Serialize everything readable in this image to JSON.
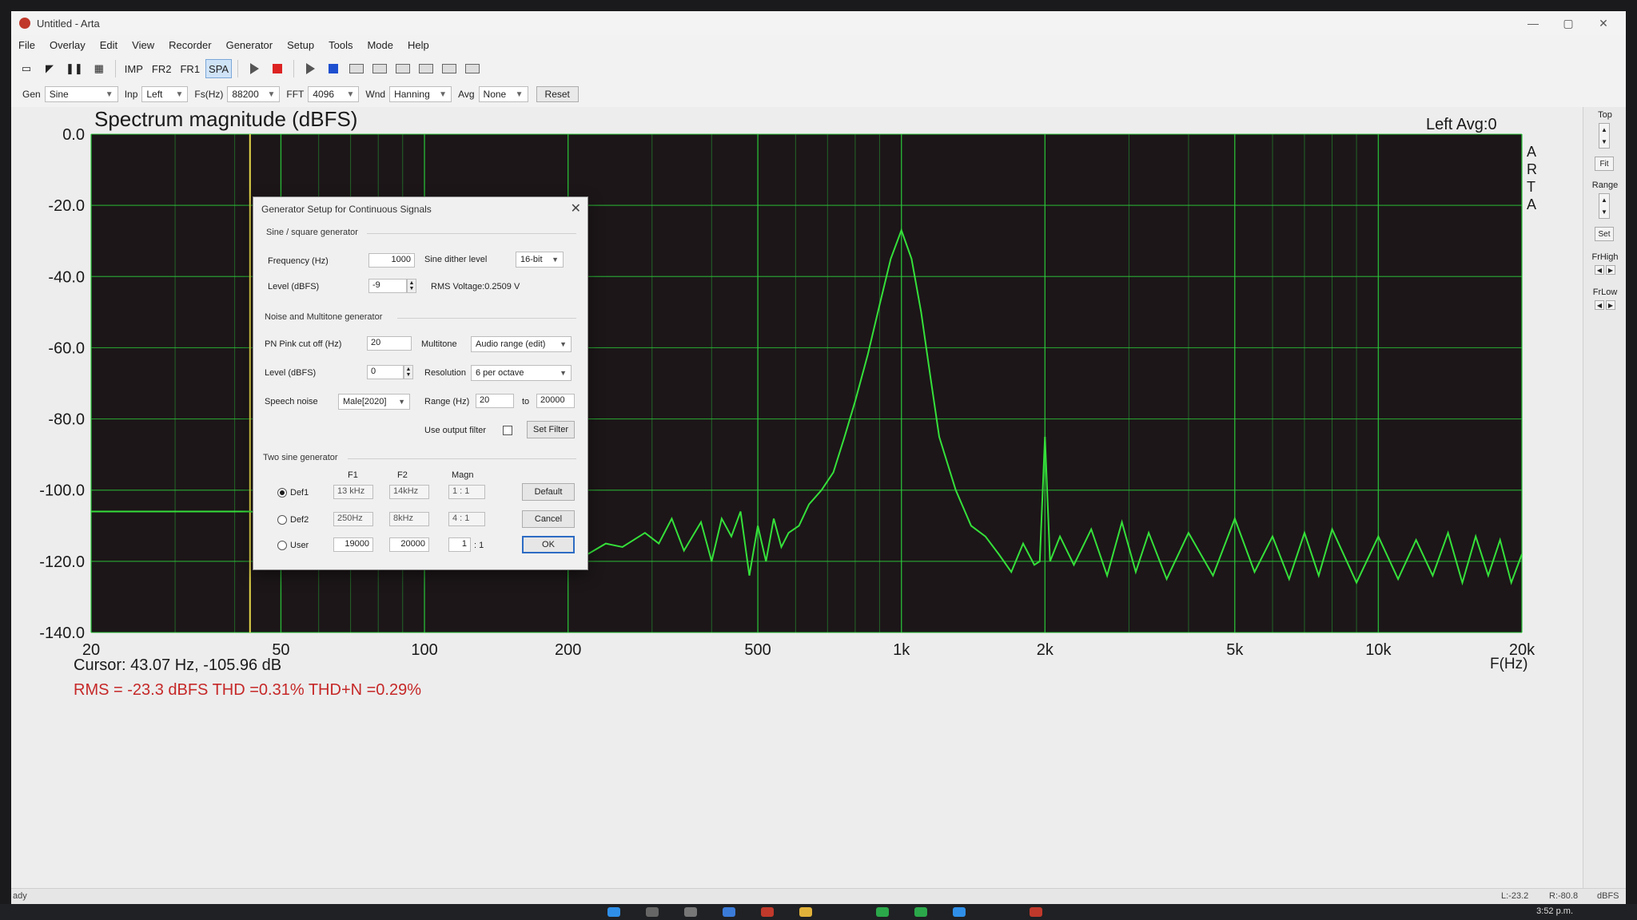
{
  "window": {
    "title": "Untitled - Arta",
    "controls": [
      "—",
      "▢",
      "✕"
    ]
  },
  "menu": [
    "File",
    "Overlay",
    "Edit",
    "View",
    "Recorder",
    "Generator",
    "Setup",
    "Tools",
    "Mode",
    "Help"
  ],
  "toolbar": {
    "imp": "IMP",
    "fr2": "FR2",
    "fr1": "FR1",
    "spa": "SPA"
  },
  "controls": {
    "gen_label": "Gen",
    "gen_value": "Sine",
    "inp_label": "Inp",
    "inp_value": "Left",
    "fs_label": "Fs(Hz)",
    "fs_value": "88200",
    "fft_label": "FFT",
    "fft_value": "4096",
    "wnd_label": "Wnd",
    "wnd_value": "Hanning",
    "avg_label": "Avg",
    "avg_value": "None",
    "reset_label": "Reset"
  },
  "plot": {
    "title": "Spectrum magnitude (dBFS)",
    "channel_info": "Left  Avg:0",
    "arta_letters": [
      "A",
      "R",
      "T",
      "A"
    ],
    "cursor_text": "Cursor: 43.07 Hz, -105.96 dB",
    "stats_text": "RMS =  -23.3 dBFS  THD =0.31%  THD+N =0.29%",
    "xlabel": "F(Hz)",
    "cursor_freq": 43.07
  },
  "chart_data": {
    "type": "line",
    "title": "Spectrum magnitude (dBFS)",
    "xlabel": "F(Hz)",
    "ylabel": "",
    "x_scale": "log",
    "xlim": [
      20,
      20000
    ],
    "ylim": [
      -140,
      0
    ],
    "x_ticks": [
      20,
      50,
      100,
      200,
      500,
      1000,
      2000,
      5000,
      10000,
      20000
    ],
    "x_tick_labels": [
      "20",
      "50",
      "100",
      "200",
      "500",
      "1k",
      "2k",
      "5k",
      "10k",
      "20k"
    ],
    "y_ticks": [
      0,
      -20,
      -40,
      -60,
      -80,
      -100,
      -120,
      -140
    ],
    "y_tick_labels": [
      "0.0",
      "-20.0",
      "-40.0",
      "-60.0",
      "-80.0",
      "-100.0",
      "-120.0",
      "-140.0"
    ],
    "grid": true,
    "series_color": "#35e03a",
    "grid_color": "#2bc83a",
    "cursor_color": "#e6d84a",
    "series": [
      {
        "name": "Left",
        "x": [
          20,
          30,
          43,
          55,
          70,
          85,
          105,
          125,
          150,
          175,
          200,
          220,
          240,
          260,
          290,
          310,
          330,
          350,
          380,
          400,
          420,
          440,
          460,
          480,
          500,
          520,
          540,
          560,
          580,
          610,
          640,
          680,
          720,
          760,
          800,
          850,
          900,
          950,
          1000,
          1050,
          1100,
          1150,
          1200,
          1300,
          1400,
          1500,
          1600,
          1700,
          1800,
          1900,
          1950,
          2000,
          2050,
          2150,
          2300,
          2500,
          2700,
          2900,
          3100,
          3300,
          3600,
          4000,
          4500,
          5000,
          5500,
          6000,
          6500,
          7000,
          7500,
          8000,
          9000,
          10000,
          11000,
          12000,
          13000,
          14000,
          15000,
          16000,
          17000,
          18000,
          19000,
          20000
        ],
        "y": [
          -106,
          -106,
          -106,
          -107,
          -121,
          -113,
          -107,
          -113,
          -116,
          -118,
          -115,
          -118,
          -115,
          -116,
          -112,
          -115,
          -108,
          -117,
          -109,
          -120,
          -108,
          -113,
          -106,
          -124,
          -110,
          -120,
          -108,
          -116,
          -112,
          -110,
          -104,
          -100,
          -95,
          -85,
          -75,
          -62,
          -48,
          -35,
          -27,
          -35,
          -50,
          -68,
          -85,
          -100,
          -110,
          -113,
          -118,
          -123,
          -115,
          -121,
          -120,
          -85,
          -120,
          -113,
          -121,
          -111,
          -124,
          -109,
          -123,
          -112,
          -125,
          -112,
          -124,
          -108,
          -123,
          -113,
          -125,
          -112,
          -124,
          -111,
          -126,
          -113,
          -125,
          -114,
          -124,
          -112,
          -126,
          -113,
          -124,
          -114,
          -126,
          -118
        ]
      }
    ]
  },
  "right_panel": {
    "top_label": "Top",
    "fit_label": "Fit",
    "range_label": "Range",
    "set_label": "Set",
    "frhigh_label": "FrHigh",
    "frlow_label": "FrLow"
  },
  "status": {
    "left": "ady",
    "l_value": "L:-23.2",
    "r_value": "R:-80.8",
    "unit": "dBFS"
  },
  "taskbar": {
    "clock": "3:52 p.m."
  },
  "dialog": {
    "title": "Generator Setup for Continuous Signals",
    "sine_group": "Sine / square generator",
    "freq_label": "Frequency (Hz)",
    "freq_value": "1000",
    "dither_label": "Sine dither level",
    "dither_value": "16-bit",
    "sine_level_label": "Level (dBFS)",
    "sine_level_value": "-9",
    "rms_voltage": "RMS Voltage:0.2509 V",
    "noise_group": "Noise and Multitone generator",
    "pn_label": "PN Pink cut off (Hz)",
    "pn_value": "20",
    "multitone_label": "Multitone",
    "multitone_value": "Audio range (edit)",
    "noise_level_label": "Level (dBFS)",
    "noise_level_value": "0",
    "resolution_label": "Resolution",
    "resolution_value": "6 per octave",
    "speech_label": "Speech noise",
    "speech_value": "Male[2020]",
    "range_label": "Range (Hz)",
    "range_from": "20",
    "range_to_label": "to",
    "range_to": "20000",
    "output_filter_label": "Use output filter",
    "set_filter_label": "Set Filter",
    "two_sine_group": "Two sine generator",
    "col_f1": "F1",
    "col_f2": "F2",
    "col_magn": "Magn",
    "def1_label": "Def1",
    "def1_f1": "13 kHz",
    "def1_f2": "14kHz",
    "def1_magn": "1 : 1",
    "def2_label": "Def2",
    "def2_f1": "250Hz",
    "def2_f2": "8kHz",
    "def2_magn": "4 : 1",
    "user_label": "User",
    "user_f1": "19000",
    "user_f2": "20000",
    "user_m1": "1",
    "user_colon": ": 1",
    "default_label": "Default",
    "cancel_label": "Cancel",
    "ok_label": "OK"
  }
}
